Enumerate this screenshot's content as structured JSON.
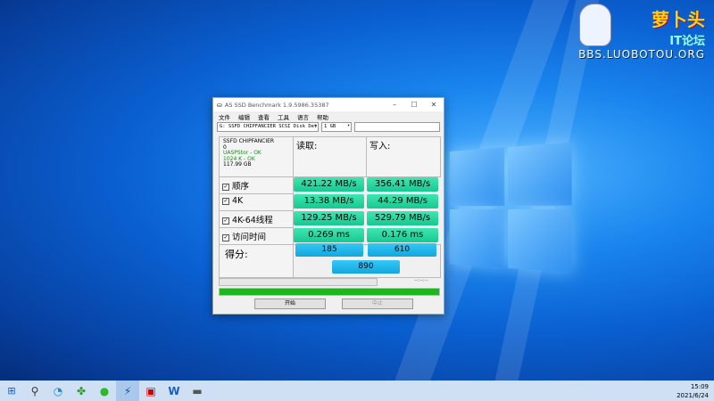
{
  "watermark": {
    "title": "萝卜头",
    "sub": "IT论坛",
    "url": "BBS.LUOBOTOU.ORG"
  },
  "app": {
    "title": "AS SSD Benchmark 1.9.5986.35387",
    "menu": [
      "文件",
      "编辑",
      "查看",
      "工具",
      "语言",
      "帮助"
    ],
    "drive_select": "G: SSFD CHIPFANCIER SCSI Disk Dev",
    "size_select": "1 GB",
    "info": {
      "name": "SSFD CHIPFANCIER",
      "num": "0",
      "driver": "UASPStor - OK",
      "align": "1024 K - OK",
      "capacity": "117.99 GB"
    },
    "col_read": "读取:",
    "col_write": "写入:",
    "rows": [
      {
        "label": "顺序",
        "read": "421.22 MB/s",
        "write": "356.41 MB/s"
      },
      {
        "label": "4K",
        "read": "13.38 MB/s",
        "write": "44.29 MB/s"
      },
      {
        "label": "4K-64线程",
        "read": "129.25 MB/s",
        "write": "529.79 MB/s"
      },
      {
        "label": "访问时间",
        "read": "0.269 ms",
        "write": "0.176 ms"
      }
    ],
    "score_label": "得分:",
    "score_read": "185",
    "score_write": "610",
    "score_total": "890",
    "time_text": "--:--:--",
    "progress": 1.0,
    "start_label": "开始",
    "stop_label": "中止"
  },
  "clock": {
    "time": "15:09",
    "date": "2021/6/24"
  }
}
